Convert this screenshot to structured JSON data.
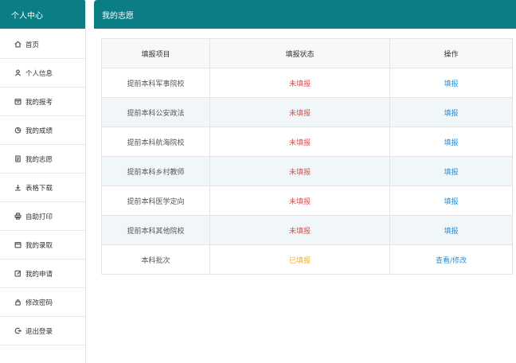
{
  "sidebar": {
    "title": "个人中心",
    "items": [
      {
        "label": "首页",
        "icon": "home-icon"
      },
      {
        "label": "个人信息",
        "icon": "user-icon"
      },
      {
        "label": "我的报考",
        "icon": "calendar-icon"
      },
      {
        "label": "我的成绩",
        "icon": "chart-icon"
      },
      {
        "label": "我的志愿",
        "icon": "document-icon"
      },
      {
        "label": "表格下载",
        "icon": "download-icon"
      },
      {
        "label": "自助打印",
        "icon": "printer-icon"
      },
      {
        "label": "我的录取",
        "icon": "calendar-check-icon"
      },
      {
        "label": "我的申请",
        "icon": "edit-icon"
      },
      {
        "label": "修改密码",
        "icon": "lock-icon"
      },
      {
        "label": "退出登录",
        "icon": "logout-icon"
      }
    ]
  },
  "main": {
    "title": "我的志愿",
    "table": {
      "headers": [
        "填报项目",
        "填报状态",
        "操作"
      ],
      "rows": [
        {
          "item": "提前本科军事院校",
          "status": "未填报",
          "status_color": "#e24a4a",
          "action": "填报"
        },
        {
          "item": "提前本科公安政法",
          "status": "未填报",
          "status_color": "#e24a4a",
          "action": "填报"
        },
        {
          "item": "提前本科航海院校",
          "status": "未填报",
          "status_color": "#e24a4a",
          "action": "填报"
        },
        {
          "item": "提前本科乡村教师",
          "status": "未填报",
          "status_color": "#e24a4a",
          "action": "填报"
        },
        {
          "item": "提前本科医学定向",
          "status": "未填报",
          "status_color": "#e24a4a",
          "action": "填报"
        },
        {
          "item": "提前本科其他院校",
          "status": "未填报",
          "status_color": "#e24a4a",
          "action": "填报"
        },
        {
          "item": "本科批次",
          "status": "已填报",
          "status_color": "#f0ad2c",
          "action": "查看/修改"
        }
      ]
    }
  },
  "colors": {
    "accent": "#0b7d84",
    "link": "#2a8fd8",
    "alt_row": "#f1f7f8"
  }
}
